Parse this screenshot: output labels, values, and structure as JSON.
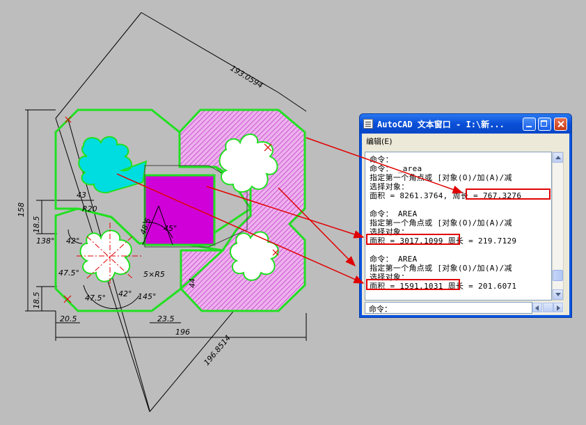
{
  "drawing": {
    "dimensions": {
      "d1": "193.0594",
      "d2": "158",
      "d3": "43",
      "d4": "R20",
      "d5": "18.5",
      "d6": "138°",
      "d7": "42°",
      "d8": "48.5",
      "d9": "45°",
      "d10": "47.5°",
      "d11": "5×R5",
      "d12": "47.5°",
      "d13": "42°",
      "d14": "145°",
      "d15": "44",
      "d16": "18.5",
      "d17": "20.5",
      "d18": "23.5",
      "d19": "196",
      "d20": "196.8514"
    },
    "colors": {
      "outline": "#21e021",
      "cyan_fill": "#00dde0",
      "magenta_fill": "#d000d8",
      "hatch": "#d860d8",
      "arrow": "#e00000",
      "highlight": "#e00000"
    }
  },
  "text_window": {
    "title": "AutoCAD 文本窗口 - I:\\新...",
    "menu_edit": "编辑(E)",
    "lines": [
      "命令：",
      "命令： _area",
      "指定第一个角点或 [对象(O)/加(A)/减",
      "选择对象：",
      "面积 = 8261.3764, 周长 = 767.3276",
      "",
      "命令： AREA",
      "指定第一个角点或 [对象(O)/加(A)/减",
      "选择对象：",
      "面积 = 3017.1099  周长 = 219.7129",
      "",
      "命令： AREA",
      "指定第一个角点或 [对象(O)/加(A)/减",
      "选择对象：",
      "面积 = 1591.1031  周长 = 201.6071"
    ],
    "command_prompt": "命令："
  }
}
